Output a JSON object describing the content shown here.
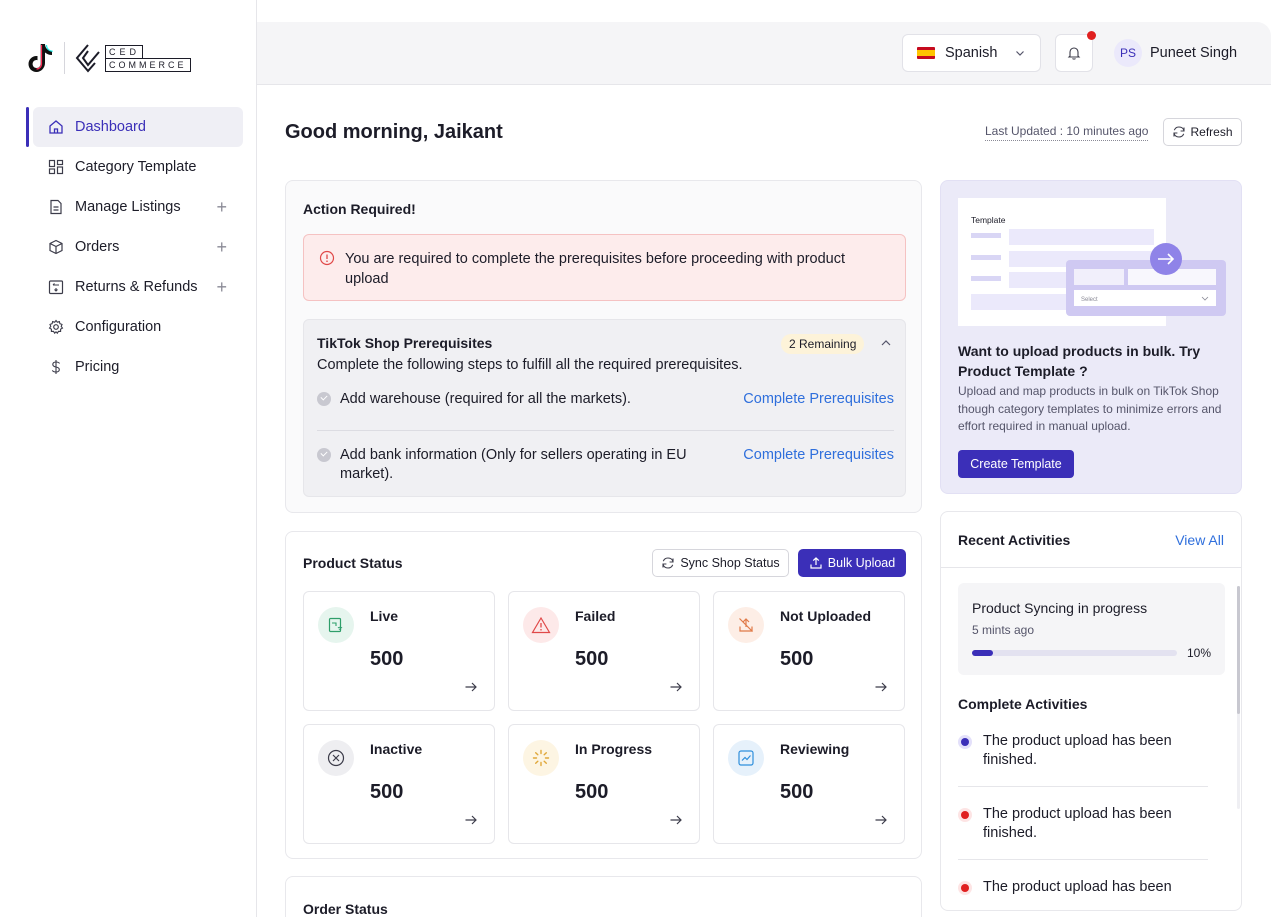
{
  "brand": {
    "logo_text_top": "CED",
    "logo_text_bottom": "COMMERCE"
  },
  "sidebar": {
    "items": [
      {
        "label": "Dashboard",
        "icon": "home-icon",
        "active": true,
        "expandable": false
      },
      {
        "label": "Category Template",
        "icon": "grid-icon",
        "active": false,
        "expandable": false
      },
      {
        "label": "Manage Listings",
        "icon": "document-icon",
        "active": false,
        "expandable": true
      },
      {
        "label": "Orders",
        "icon": "box-icon",
        "active": false,
        "expandable": true
      },
      {
        "label": "Returns & Refunds",
        "icon": "return-icon",
        "active": false,
        "expandable": true
      },
      {
        "label": "Configuration",
        "icon": "gear-icon",
        "active": false,
        "expandable": false
      },
      {
        "label": "Pricing",
        "icon": "dollar-icon",
        "active": false,
        "expandable": false
      }
    ]
  },
  "topbar": {
    "language": "Spanish",
    "user_initials": "PS",
    "user_name": "Puneet Singh"
  },
  "header": {
    "greeting": "Good morning, Jaikant",
    "last_updated": "Last Updated : 10 minutes ago",
    "refresh_label": "Refresh"
  },
  "action_required": {
    "title": "Action Required!",
    "alert": "You are required to complete the prerequisites before proceeding with product upload",
    "prereq_title": "TikTok Shop Prerequisites",
    "prereq_badge": "2 Remaining",
    "prereq_subtitle": "Complete the following steps to fulfill all the required prerequisites.",
    "steps": [
      {
        "text": "Add warehouse (required for all the markets).",
        "link": "Complete Prerequisites"
      },
      {
        "text": "Add bank information (Only for sellers operating in EU market).",
        "link": "Complete Prerequisites"
      }
    ]
  },
  "product_status": {
    "title": "Product Status",
    "sync_label": "Sync Shop Status",
    "bulk_label": "Bulk Upload",
    "stats": [
      {
        "label": "Live",
        "value": "500",
        "icon": "live-icon",
        "color": "#2e9e6a",
        "bg": "#e6f5ee"
      },
      {
        "label": "Failed",
        "value": "500",
        "icon": "warning-icon",
        "color": "#e04848",
        "bg": "#fde9e9"
      },
      {
        "label": "Not Uploaded",
        "value": "500",
        "icon": "upload-off-icon",
        "color": "#e07a48",
        "bg": "#fdeee6"
      },
      {
        "label": "Inactive",
        "value": "500",
        "icon": "close-circle-icon",
        "color": "#3c3c4a",
        "bg": "#eeeef1"
      },
      {
        "label": "In Progress",
        "value": "500",
        "icon": "spinner-icon",
        "color": "#e0a83a",
        "bg": "#fdf5e3"
      },
      {
        "label": "Reviewing",
        "value": "500",
        "icon": "review-icon",
        "color": "#2f8fdc",
        "bg": "#e6f1fb"
      }
    ]
  },
  "order_status": {
    "title": "Order Status"
  },
  "template_promo": {
    "illus_label": "Template",
    "illus_select": "Select",
    "title": "Want to upload products in bulk. Try Product Template ?",
    "description": "Upload and map products in bulk on TikTok Shop though category templates to minimize errors and effort required in manual upload.",
    "button": "Create Template"
  },
  "recent": {
    "title": "Recent Activities",
    "view_all": "View All",
    "sync_title": "Product Syncing in progress",
    "sync_time": "5 mints ago",
    "progress_fraction": 0.1,
    "progress_label": "10%",
    "complete_title": "Complete Activities",
    "activities": [
      {
        "text": "The product upload has been finished.",
        "color": "#3b2fb8"
      },
      {
        "text": "The product upload has been finished.",
        "color": "#e02020"
      },
      {
        "text": "The product upload has been",
        "color": "#e02020"
      }
    ]
  },
  "colors": {
    "accent": "#3b2fb8",
    "link": "#2f6fdc",
    "danger": "#e02020"
  }
}
